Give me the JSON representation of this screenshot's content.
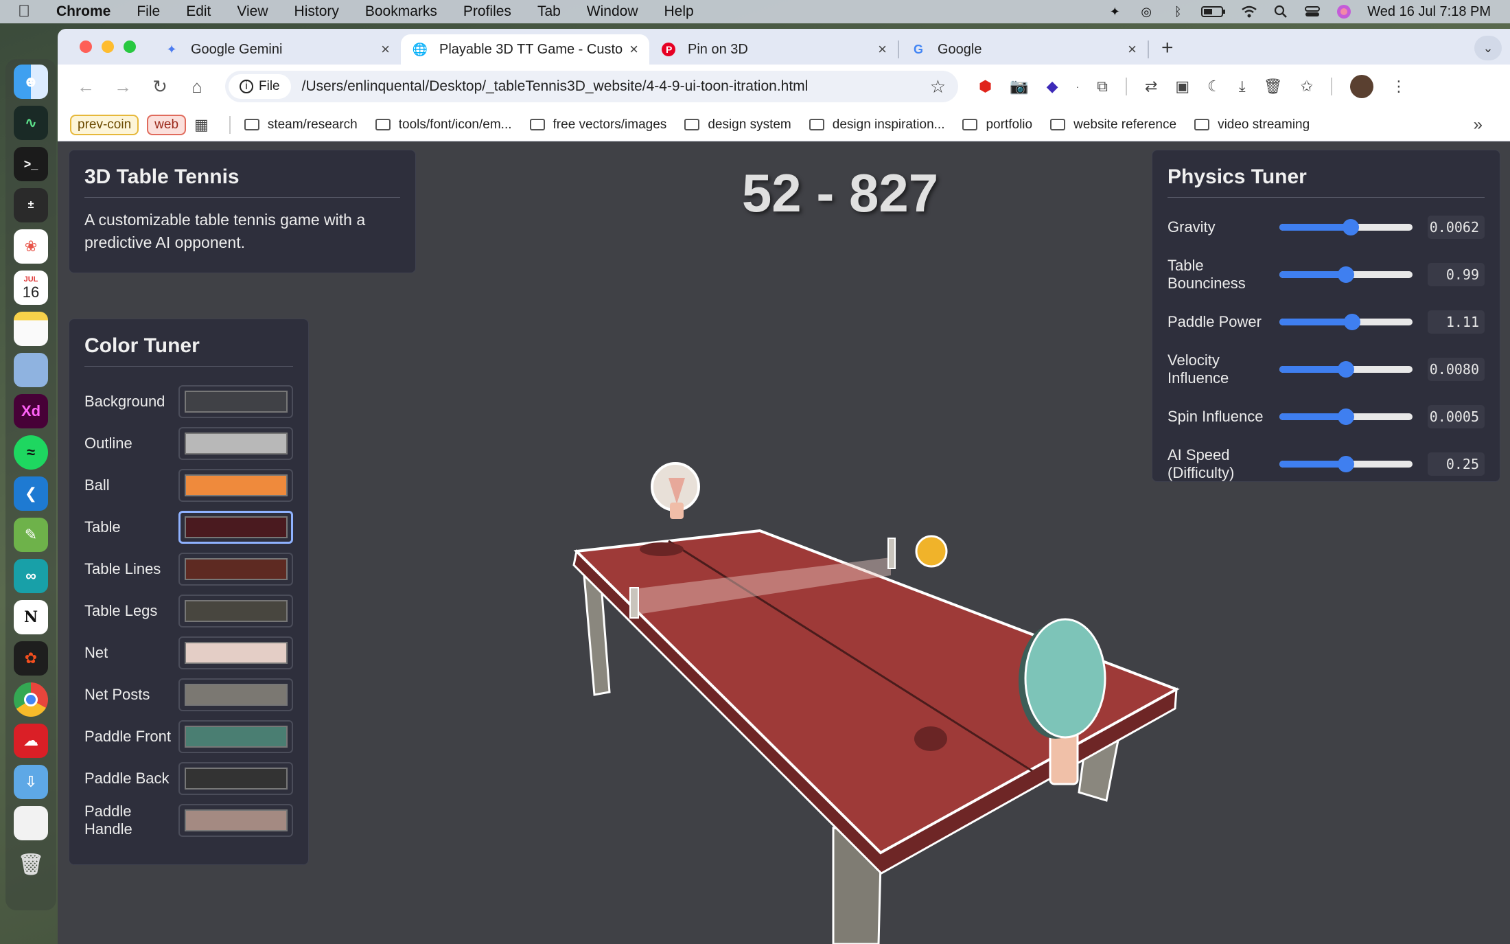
{
  "menubar": {
    "app": "Chrome",
    "items": [
      "File",
      "Edit",
      "View",
      "History",
      "Bookmarks",
      "Profiles",
      "Tab",
      "Window",
      "Help"
    ],
    "clock": "Wed 16 Jul  7:18 PM"
  },
  "dock": {
    "calendar_month": "JUL",
    "calendar_day": "16",
    "xd_label": "Xd"
  },
  "tabs": [
    {
      "title": "Google Gemini",
      "icon": "gemini-icon"
    },
    {
      "title": "Playable 3D TT Game - Custo",
      "icon": "globe-icon"
    },
    {
      "title": "Pin on 3D",
      "icon": "pinterest-icon"
    },
    {
      "title": "Google",
      "icon": "google-icon"
    }
  ],
  "omnibox": {
    "chip": "File",
    "url": "/Users/enlinquental/Desktop/_tableTennis3D_website/4-4-9-ui-toon-itration.html"
  },
  "bookmarks": {
    "chips": [
      "prev-coin",
      "web"
    ],
    "folders": [
      "steam/research",
      "tools/font/icon/em...",
      "free vectors/images",
      "design system",
      "design inspiration...",
      "portfolio",
      "website reference",
      "video streaming"
    ]
  },
  "info": {
    "title": "3D Table Tennis",
    "description": "A customizable table tennis game with a predictive AI opponent."
  },
  "score": "52 - 827",
  "color_tuner": {
    "title": "Color Tuner",
    "rows": [
      {
        "label": "Background",
        "color": "#404146"
      },
      {
        "label": "Outline",
        "color": "#b8b8b8"
      },
      {
        "label": "Ball",
        "color": "#ef8a3c"
      },
      {
        "label": "Table",
        "color": "#4a1a1f"
      },
      {
        "label": "Table Lines",
        "color": "#5e2a22"
      },
      {
        "label": "Table Legs",
        "color": "#48463f"
      },
      {
        "label": "Net",
        "color": "#e4cec6"
      },
      {
        "label": "Net Posts",
        "color": "#7b7872"
      },
      {
        "label": "Paddle Front",
        "color": "#4a7e72"
      },
      {
        "label": "Paddle Back",
        "color": "#333333"
      },
      {
        "label": "Paddle Handle",
        "color": "#a48a82"
      }
    ]
  },
  "physics_tuner": {
    "title": "Physics Tuner",
    "rows": [
      {
        "label": "Gravity",
        "value": "0.0062",
        "level": 0.54
      },
      {
        "label": "Table Bounciness",
        "value": "0.99",
        "level": 0.5
      },
      {
        "label": "Paddle Power",
        "value": "1.11",
        "level": 0.55
      },
      {
        "label": "Velocity Influence",
        "value": "0.0080",
        "level": 0.5
      },
      {
        "label": "Spin Influence",
        "value": "0.0005",
        "level": 0.5
      },
      {
        "label": "AI Speed (Difficulty)",
        "value": "0.25",
        "level": 0.5
      }
    ]
  },
  "colors": {
    "table_top": "#9e3a38",
    "table_side": "#6e2626",
    "legs": "#7a776e",
    "ball": "#f0b32a",
    "paddle_face": "#7dc4b8",
    "paddle_handle": "#f0c0a8",
    "slider_accent": "#3f7ff0"
  }
}
